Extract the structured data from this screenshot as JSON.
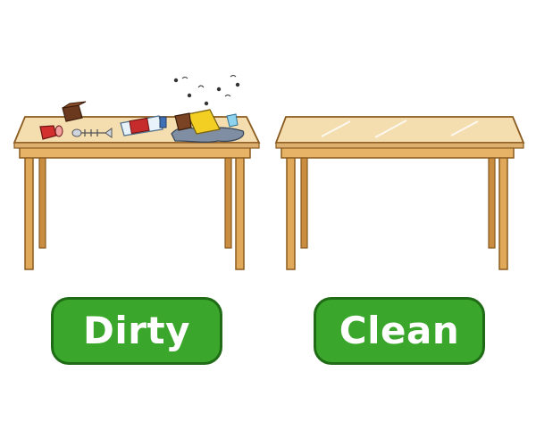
{
  "labels": {
    "left": "Dirty",
    "right": "Clean"
  },
  "colors": {
    "badge_fill": "#3aa62b",
    "badge_border": "#1f6b16",
    "table_top": "#f4deb0",
    "table_wood": "#e0a95a",
    "table_outline": "#8a5a1e"
  },
  "icons": {
    "left_table": "dirty-table-icon",
    "right_table": "clean-table-icon"
  }
}
